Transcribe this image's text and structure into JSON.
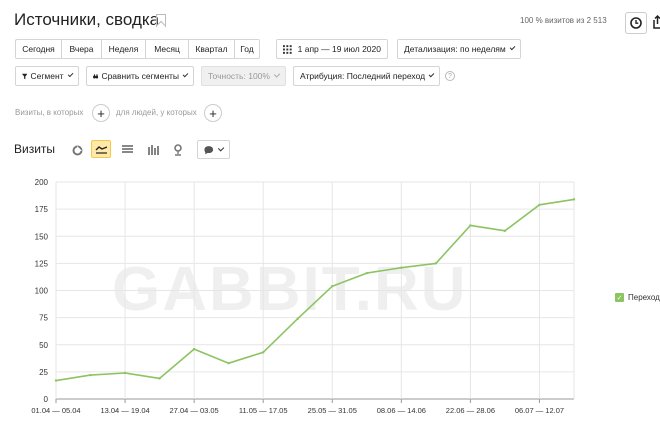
{
  "header": {
    "title": "Источники, сводка",
    "visits_share": "100 % визитов из 2 513"
  },
  "period_buttons": [
    "Сегодня",
    "Вчера",
    "Неделя",
    "Месяц",
    "Квартал",
    "Год"
  ],
  "date_range": "1 апр — 19 июл 2020",
  "detail": "Детализация: по неделям",
  "toolbar2": {
    "segment": "Сегмент",
    "compare": "Сравнить сегменты",
    "accuracy": "Точность: 100%",
    "attribution": "Атрибуция: Последний переход"
  },
  "filters": {
    "visits_label": "Визиты, в которых",
    "people_label": "для людей, у которых"
  },
  "chart_section": {
    "title": "Визиты"
  },
  "watermark": "GABBIT.RU",
  "chart_data": {
    "type": "line",
    "series": [
      {
        "name": "Переход",
        "color": "#8cc462",
        "values": [
          17,
          22,
          24,
          19,
          46,
          33,
          43,
          74,
          104,
          116,
          121,
          125,
          160,
          155,
          179,
          184
        ]
      }
    ],
    "ylim": [
      0,
      200
    ],
    "yticks": [
      0,
      25,
      50,
      75,
      100,
      125,
      150,
      175,
      200
    ],
    "xticks": [
      "01.04 — 05.04",
      "13.04 — 19.04",
      "27.04 — 03.05",
      "11.05 — 17.05",
      "25.05 — 31.05",
      "08.06 — 14.06",
      "22.06 — 28.06",
      "06.07 — 12.07"
    ],
    "grid": true,
    "legend": "right"
  }
}
